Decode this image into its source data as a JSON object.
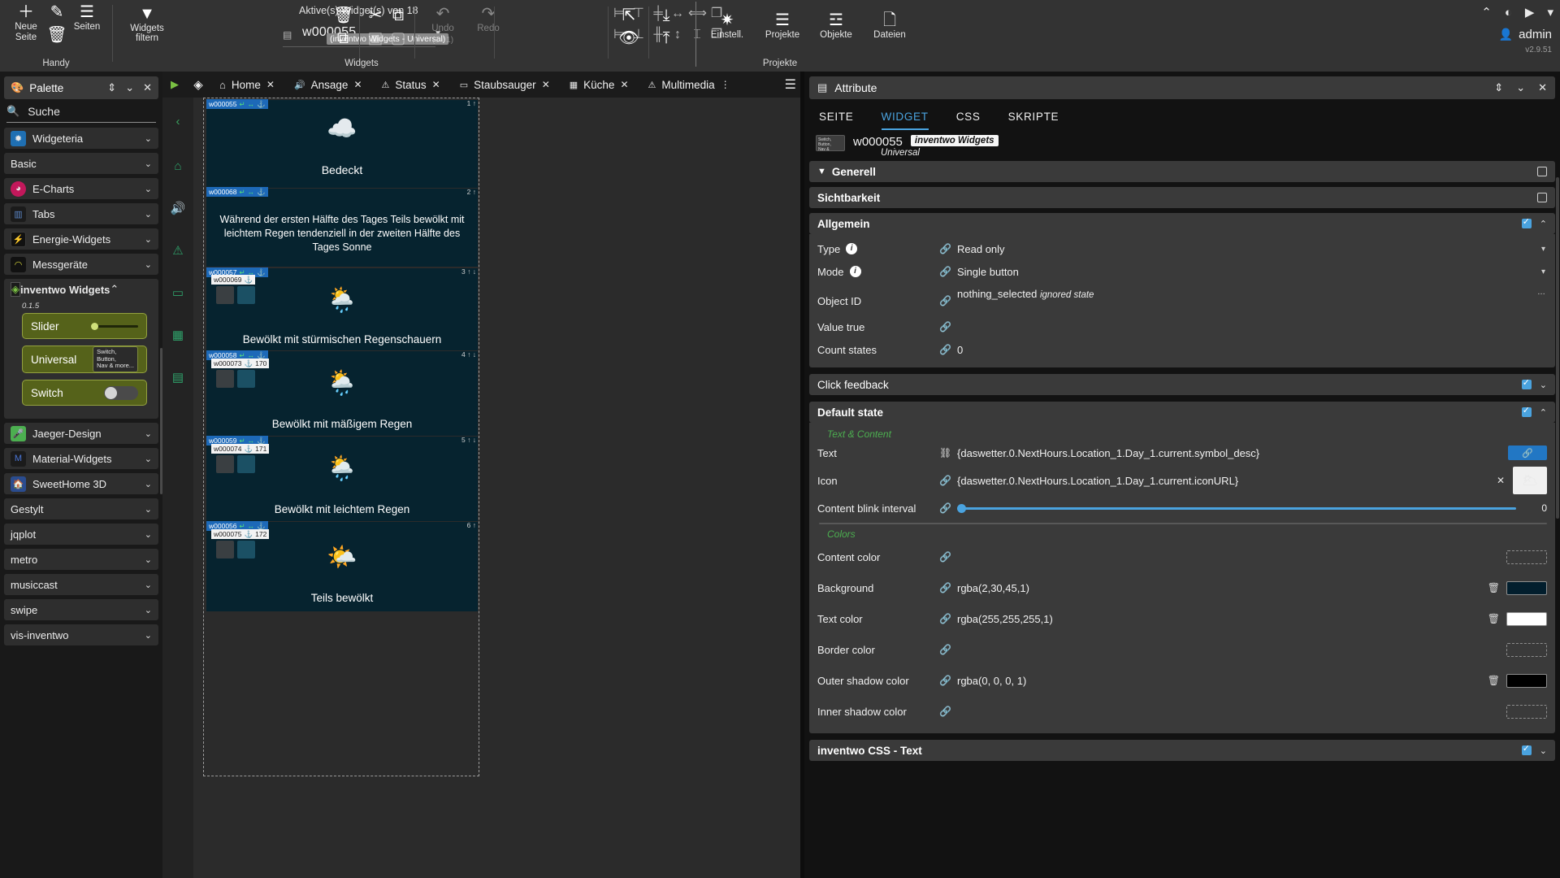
{
  "ribbon": {
    "groups": [
      {
        "caption": "Handy"
      },
      {
        "caption": "Widgets"
      },
      {
        "caption": "Projekte"
      }
    ],
    "page_tools": [
      {
        "name": "new-page",
        "label": "Neue\nSeite",
        "glyph": "+"
      },
      {
        "name": "edit-page",
        "label": "",
        "glyph": "✎"
      },
      {
        "name": "delete-page",
        "label": "",
        "glyph": "🗑"
      },
      {
        "name": "pages",
        "label": "Seiten",
        "glyph": "☰"
      }
    ],
    "new_page_label": "Neue Seite",
    "pages_label": "Seiten",
    "filter_label": "Widgets filtern",
    "widget_count": "Aktive(s) Widget(s) von 18",
    "widget_id": "w000055",
    "widget_tooltip": "(inventwo Widgets - Universal)",
    "undo_label": "Undo",
    "undo_count": "(1 / 1)",
    "redo_label": "Redo",
    "settings_label": "Einstell.",
    "projects_label": "Projekte",
    "objects_label": "Objekte",
    "files_label": "Dateien",
    "user_name": "admin",
    "version": "v2.9.51"
  },
  "palette": {
    "title": "Palette",
    "search_placeholder": "Suche",
    "items": [
      {
        "label": "Widgeteria",
        "icon": "widgeteria-icon",
        "color": "#1f6fb2",
        "open": false
      },
      {
        "label": "Basic",
        "icon": null,
        "color": "",
        "open": false
      },
      {
        "label": "E-Charts",
        "icon": "echarts-icon",
        "color": "#c2185b",
        "open": false
      },
      {
        "label": "Tabs",
        "icon": "tabs-icon",
        "color": "#2d4a7a",
        "open": false
      },
      {
        "label": "Energie-Widgets",
        "icon": "bolt-icon",
        "color": "#1b1b1b",
        "open": false
      },
      {
        "label": "Messgeräte",
        "icon": "gauge-icon",
        "color": "#1b1b1b",
        "open": false
      }
    ],
    "open_group": {
      "label": "inventwo Widgets",
      "version": "0.1.5",
      "widgets": [
        {
          "name": "Slider",
          "preview": "slider"
        },
        {
          "name": "Universal",
          "preview": "badge",
          "badge": "Switch,\nButton,\nNav & more..."
        },
        {
          "name": "Switch",
          "preview": "switch"
        }
      ]
    },
    "items_after": [
      {
        "label": "Jaeger-Design",
        "icon": "jaeger-icon",
        "color": "#4caf50"
      },
      {
        "label": "Material-Widgets",
        "icon": "material-icon",
        "color": "#1b1b1b"
      },
      {
        "label": "SweetHome 3D",
        "icon": "sweethome-icon",
        "color": "#2a4c8f"
      },
      {
        "label": "Gestylt",
        "icon": null,
        "color": ""
      },
      {
        "label": "jqplot",
        "icon": null,
        "color": ""
      },
      {
        "label": "metro",
        "icon": null,
        "color": ""
      },
      {
        "label": "musiccast",
        "icon": null,
        "color": ""
      },
      {
        "label": "swipe",
        "icon": null,
        "color": ""
      },
      {
        "label": "vis-inventwo",
        "icon": null,
        "color": ""
      }
    ]
  },
  "editor": {
    "tabs": [
      {
        "label": "Home",
        "icon": "home-icon"
      },
      {
        "label": "Ansage",
        "icon": "speaker-icon"
      },
      {
        "label": "Status",
        "icon": "alert-icon"
      },
      {
        "label": "Staubsauger",
        "icon": "vacuum-icon"
      },
      {
        "label": "Küche",
        "icon": "kitchen-icon"
      },
      {
        "label": "Multimedia",
        "icon": "multimedia-icon"
      }
    ],
    "close_label": "✕",
    "canvas_widgets": [
      {
        "id": "w000055",
        "text": "Bedeckt",
        "icon": "cloud-overcast",
        "num": "1",
        "arrow": "↑"
      },
      {
        "id": "w000068",
        "text": "Während der ersten Hälfte des Tages Teils bewölkt mit leichtem Regen tendenziell in der zweiten Hälfte des Tages Sonne",
        "icon": "",
        "num": "2",
        "arrow": "↑"
      },
      {
        "id": "w000057",
        "id2": "w000069",
        "text": "Bewölkt mit stürmischen Regenschauern",
        "icon": "cloud-sun-rain",
        "num": "3",
        "arrow": "↑"
      },
      {
        "id": "w000058",
        "id2": "w000073",
        "id3": "170",
        "text": "Bewölkt mit mäßigem Regen",
        "icon": "cloud-sun-rain",
        "num": "4",
        "arrow": "↑"
      },
      {
        "id": "w000059",
        "id2": "w000074",
        "id3": "171",
        "text": "Bewölkt mit leichtem Regen",
        "icon": "cloud-sun-rain",
        "num": "5",
        "arrow": "↑"
      },
      {
        "id": "w000056",
        "id2": "w000075",
        "id3": "172",
        "text": "Teils bewölkt",
        "icon": "sun-cloud",
        "num": "6",
        "arrow": "↑"
      }
    ]
  },
  "attributes": {
    "title": "Attribute",
    "tabs": [
      {
        "label": "SEITE",
        "active": false
      },
      {
        "label": "WIDGET",
        "active": true
      },
      {
        "label": "CSS",
        "active": false
      },
      {
        "label": "SKRIPTE",
        "active": false
      }
    ],
    "widget_id": "w000055",
    "widget_type_tip": "inventwo Widgets",
    "widget_subtype": "Universal",
    "thumb_text": "Switch,\nButton,\nNav & more...",
    "sections": [
      {
        "title": "Generell",
        "checkbox": "empty",
        "funnel": true
      },
      {
        "title": "Sichtbarkeit",
        "checkbox": "empty",
        "funnel": false
      }
    ],
    "allgemein": {
      "title": "Allgemein",
      "rows": [
        {
          "label": "Type",
          "info": true,
          "value": "Read only",
          "select": true
        },
        {
          "label": "Mode",
          "info": true,
          "value": "Single button",
          "select": true
        },
        {
          "label": "Object ID",
          "info": false,
          "value": "nothing_selected",
          "note": "ignored state",
          "dots": "..."
        },
        {
          "label": "Value true",
          "info": false,
          "value": ""
        },
        {
          "label": "Count states",
          "info": false,
          "value": "0"
        }
      ]
    },
    "click_feedback": {
      "title": "Click feedback",
      "checkbox": "on"
    },
    "default_state": {
      "title": "Default state",
      "checkbox": "on",
      "group_text_content": "Text & Content",
      "group_colors": "Colors",
      "text_row": {
        "label": "Text",
        "value": "{daswetter.0.NextHours.Location_1.Day_1.current.symbol_desc}",
        "link_button": "🔗"
      },
      "icon_row": {
        "label": "Icon",
        "value": "{daswetter.0.NextHours.Location_1.Day_1.current.iconURL}"
      },
      "blink_row": {
        "label": "Content blink interval",
        "value": "0"
      },
      "colors": [
        {
          "label": "Content color",
          "value": "",
          "swatch": "",
          "empty": true
        },
        {
          "label": "Background",
          "value": "rgba(2,30,45,1)",
          "swatch": "#021e2d",
          "empty": false
        },
        {
          "label": "Text color",
          "value": "rgba(255,255,255,1)",
          "swatch": "#ffffff",
          "empty": false
        },
        {
          "label": "Border color",
          "value": "",
          "swatch": "",
          "empty": true
        },
        {
          "label": "Outer shadow color",
          "value": "rgba(0, 0, 0, 1)",
          "swatch": "#000000",
          "empty": false
        },
        {
          "label": "Inner shadow color",
          "value": "",
          "swatch": "",
          "empty": true
        }
      ]
    },
    "css_section": {
      "title": "inventwo CSS - Text",
      "checkbox": "on"
    }
  }
}
